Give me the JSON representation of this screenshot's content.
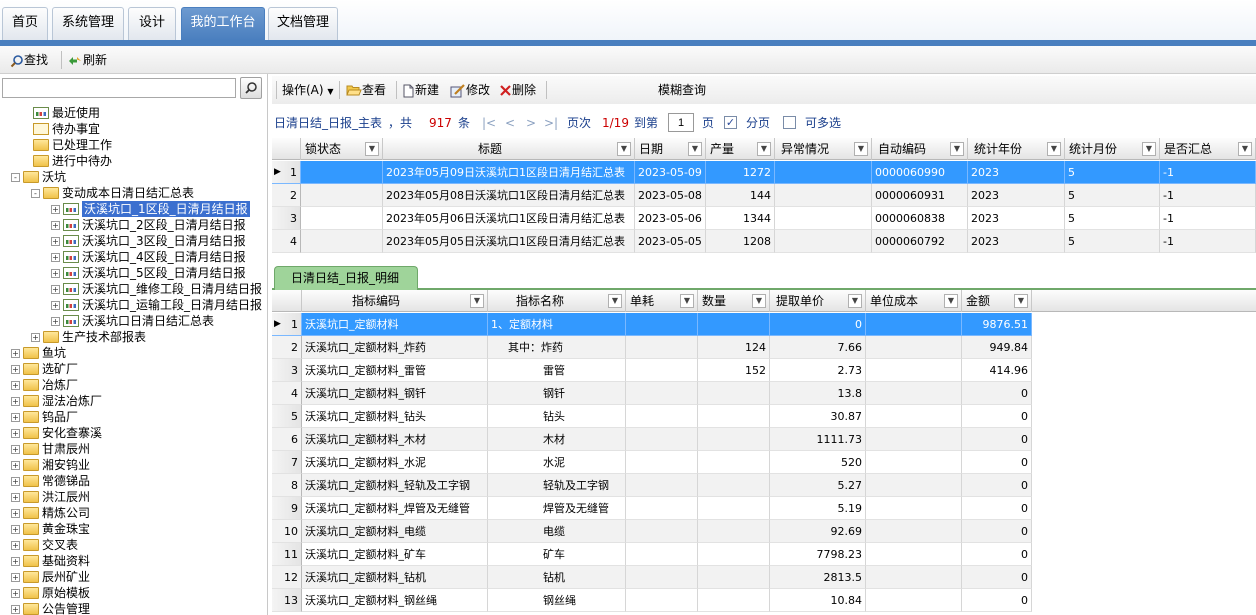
{
  "nav": {
    "tabs": [
      {
        "label": "首页",
        "active": false
      },
      {
        "label": "系统管理",
        "active": false
      },
      {
        "label": "设计",
        "active": false
      },
      {
        "label": "我的工作台",
        "active": true
      },
      {
        "label": "文档管理",
        "active": false
      }
    ]
  },
  "toolbar1": {
    "find": "查找",
    "refresh": "刷新"
  },
  "tree": [
    {
      "label": "最近使用",
      "icon": "report"
    },
    {
      "label": "待办事宜",
      "icon": "mail"
    },
    {
      "label": "已处理工作",
      "icon": "folder"
    },
    {
      "label": "进行中待办",
      "icon": "folder"
    },
    {
      "label": "沃坑",
      "icon": "folder",
      "expander": "-"
    },
    {
      "label": "变动成本日清日结汇总表",
      "icon": "folder",
      "expander": "-"
    },
    {
      "label": "沃溪坑口_1区段_日清月结日报",
      "icon": "report",
      "expander": "+",
      "selected": true
    },
    {
      "label": "沃溪坑口_2区段_日清月结日报",
      "icon": "report",
      "expander": "+"
    },
    {
      "label": "沃溪坑口_3区段_日清月结日报",
      "icon": "report",
      "expander": "+"
    },
    {
      "label": "沃溪坑口_4区段_日清月结日报",
      "icon": "report",
      "expander": "+"
    },
    {
      "label": "沃溪坑口_5区段_日清月结日报",
      "icon": "report",
      "expander": "+"
    },
    {
      "label": "沃溪坑口_维修工段_日清月结日报",
      "icon": "report",
      "expander": "+"
    },
    {
      "label": "沃溪坑口_运输工段_日清月结日报",
      "icon": "report",
      "expander": "+"
    },
    {
      "label": "沃溪坑口日清日结汇总表",
      "icon": "report",
      "expander": "+"
    },
    {
      "label": "生产技术部报表",
      "icon": "folder",
      "expander": "+"
    },
    {
      "label": "鱼坑",
      "icon": "folder",
      "expander": "+"
    },
    {
      "label": "选矿厂",
      "icon": "folder",
      "expander": "+"
    },
    {
      "label": "冶炼厂",
      "icon": "folder",
      "expander": "+"
    },
    {
      "label": "湿法冶炼厂",
      "icon": "folder",
      "expander": "+"
    },
    {
      "label": "钨品厂",
      "icon": "folder",
      "expander": "+"
    },
    {
      "label": "安化查寨溪",
      "icon": "folder",
      "expander": "+"
    },
    {
      "label": "甘肃辰州",
      "icon": "folder",
      "expander": "+"
    },
    {
      "label": "湘安钨业",
      "icon": "folder",
      "expander": "+"
    },
    {
      "label": "常德锑品",
      "icon": "folder",
      "expander": "+"
    },
    {
      "label": "洪江辰州",
      "icon": "folder",
      "expander": "+"
    },
    {
      "label": "精炼公司",
      "icon": "folder",
      "expander": "+"
    },
    {
      "label": "黄金珠宝",
      "icon": "folder",
      "expander": "+"
    },
    {
      "label": "交叉表",
      "icon": "folder",
      "expander": "+"
    },
    {
      "label": "基础资料",
      "icon": "folder",
      "expander": "+"
    },
    {
      "label": "辰州矿业",
      "icon": "folder",
      "expander": "+"
    },
    {
      "label": "原始模板",
      "icon": "folder",
      "expander": "+"
    },
    {
      "label": "公告管理",
      "icon": "folder",
      "expander": "+"
    }
  ],
  "toolbar2": {
    "operate": "操作(A)",
    "view": "查看",
    "new": "新建",
    "edit": "修改",
    "delete": "删除",
    "fuzzy": "模糊查询"
  },
  "recinfo": {
    "title": "日清日结_日报_主表",
    "total_prefix": "，共",
    "total": "917",
    "total_suffix": "条",
    "page_label": "页次",
    "page": "1/19",
    "goto_label": "到第",
    "goto_value": "1",
    "page_unit": "页",
    "paging": "分页",
    "multi": "可多选"
  },
  "master": {
    "columns": [
      "锁状态",
      "标题",
      "日期",
      "产量",
      "异常情况",
      "自动编码",
      "统计年份",
      "统计月份",
      "是否汇总"
    ],
    "rows": [
      {
        "n": "1",
        "lock": "",
        "title": "2023年05月09日沃溪坑口1区段日清月结汇总表",
        "date": "2023-05-09",
        "output": "1272",
        "abn": "",
        "code": "0000060990",
        "year": "2023",
        "month": "5",
        "sum": "-1"
      },
      {
        "n": "2",
        "lock": "",
        "title": "2023年05月08日沃溪坑口1区段日清月结汇总表",
        "date": "2023-05-08",
        "output": "144",
        "abn": "",
        "code": "0000060931",
        "year": "2023",
        "month": "5",
        "sum": "-1"
      },
      {
        "n": "3",
        "lock": "",
        "title": "2023年05月06日沃溪坑口1区段日清月结汇总表",
        "date": "2023-05-06",
        "output": "1344",
        "abn": "",
        "code": "0000060838",
        "year": "2023",
        "month": "5",
        "sum": "-1"
      },
      {
        "n": "4",
        "lock": "",
        "title": "2023年05月05日沃溪坑口1区段日清月结汇总表",
        "date": "2023-05-05",
        "output": "1208",
        "abn": "",
        "code": "0000060792",
        "year": "2023",
        "month": "5",
        "sum": "-1"
      }
    ]
  },
  "detail": {
    "tab": "日清日结_日报_明细",
    "columns": [
      "指标编码",
      "指标名称",
      "单耗",
      "数量",
      "提取单价",
      "单位成本",
      "金额"
    ],
    "rows": [
      {
        "n": "1",
        "code": "沃溪坑口_定额材料",
        "name": "1、定额材料",
        "unit": "",
        "qty": "",
        "price": "0",
        "ucost": "",
        "amount": "9876.51"
      },
      {
        "n": "2",
        "code": "沃溪坑口_定额材料_炸药",
        "name": "其中：炸药",
        "unit": "",
        "qty": "124",
        "price": "7.66",
        "ucost": "",
        "amount": "949.84"
      },
      {
        "n": "3",
        "code": "沃溪坑口_定额材料_雷管",
        "name": "雷管",
        "unit": "",
        "qty": "152",
        "price": "2.73",
        "ucost": "",
        "amount": "414.96"
      },
      {
        "n": "4",
        "code": "沃溪坑口_定额材料_钢钎",
        "name": "钢钎",
        "unit": "",
        "qty": "",
        "price": "13.8",
        "ucost": "",
        "amount": "0"
      },
      {
        "n": "5",
        "code": "沃溪坑口_定额材料_钻头",
        "name": "钻头",
        "unit": "",
        "qty": "",
        "price": "30.87",
        "ucost": "",
        "amount": "0"
      },
      {
        "n": "6",
        "code": "沃溪坑口_定额材料_木材",
        "name": "木材",
        "unit": "",
        "qty": "",
        "price": "1111.73",
        "ucost": "",
        "amount": "0"
      },
      {
        "n": "7",
        "code": "沃溪坑口_定额材料_水泥",
        "name": "水泥",
        "unit": "",
        "qty": "",
        "price": "520",
        "ucost": "",
        "amount": "0"
      },
      {
        "n": "8",
        "code": "沃溪坑口_定额材料_轻轨及工字钢",
        "name": "轻轨及工字钢",
        "unit": "",
        "qty": "",
        "price": "5.27",
        "ucost": "",
        "amount": "0"
      },
      {
        "n": "9",
        "code": "沃溪坑口_定额材料_焊管及无缝管",
        "name": "焊管及无缝管",
        "unit": "",
        "qty": "",
        "price": "5.19",
        "ucost": "",
        "amount": "0"
      },
      {
        "n": "10",
        "code": "沃溪坑口_定额材料_电缆",
        "name": "电缆",
        "unit": "",
        "qty": "",
        "price": "92.69",
        "ucost": "",
        "amount": "0"
      },
      {
        "n": "11",
        "code": "沃溪坑口_定额材料_矿车",
        "name": "矿车",
        "unit": "",
        "qty": "",
        "price": "7798.23",
        "ucost": "",
        "amount": "0"
      },
      {
        "n": "12",
        "code": "沃溪坑口_定额材料_钻机",
        "name": "钻机",
        "unit": "",
        "qty": "",
        "price": "2813.5",
        "ucost": "",
        "amount": "0"
      },
      {
        "n": "13",
        "code": "沃溪坑口_定额材料_钢丝绳",
        "name": "钢丝绳",
        "unit": "",
        "qty": "",
        "price": "10.84",
        "ucost": "",
        "amount": "0"
      }
    ]
  },
  "colors": {
    "accent": "#4a7fbf",
    "selection": "#3399ff",
    "detail_tab": "#9fd49a",
    "count": "#cc0000"
  }
}
